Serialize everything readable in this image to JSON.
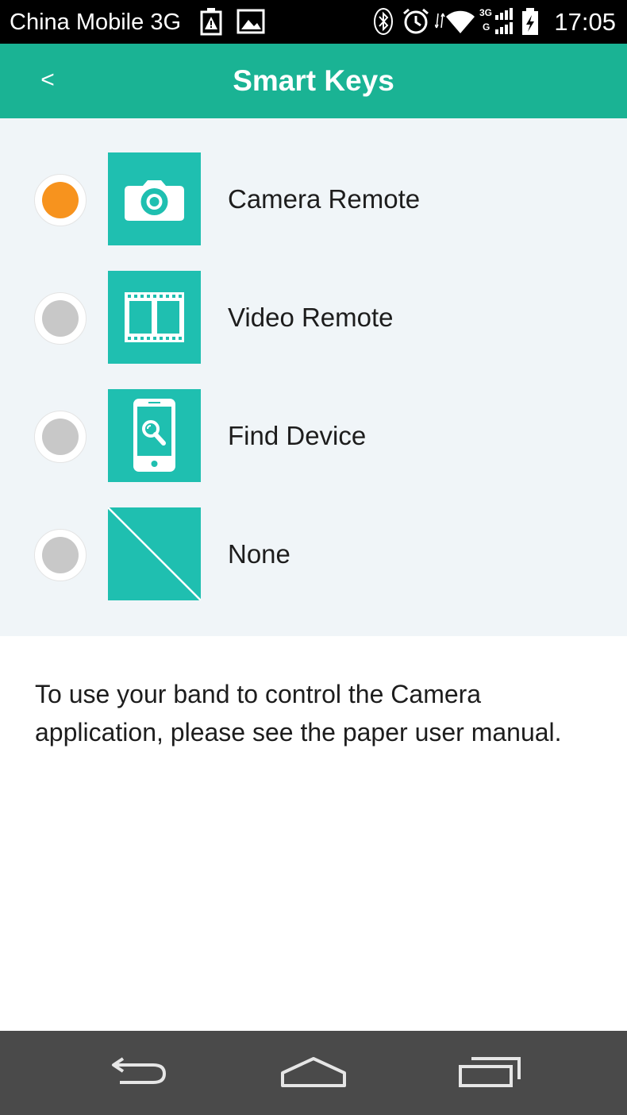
{
  "status_bar": {
    "carrier": "China Mobile 3G",
    "signal_label_top": "3G",
    "signal_label_bottom": "G",
    "time": "17:05"
  },
  "header": {
    "back_label": "<",
    "title": "Smart Keys"
  },
  "options": [
    {
      "label": "Camera Remote",
      "icon": "camera-icon",
      "selected": true
    },
    {
      "label": "Video Remote",
      "icon": "film-icon",
      "selected": false
    },
    {
      "label": "Find Device",
      "icon": "find-phone-icon",
      "selected": false
    },
    {
      "label": "None",
      "icon": "none-icon",
      "selected": false
    }
  ],
  "note": "To use your band to control the Camera application, please see the paper user manual.",
  "colors": {
    "accent": "#1ab394",
    "tile": "#1fbfb0",
    "selected_radio": "#f7931e",
    "unselected_radio": "#c8c8c8"
  }
}
